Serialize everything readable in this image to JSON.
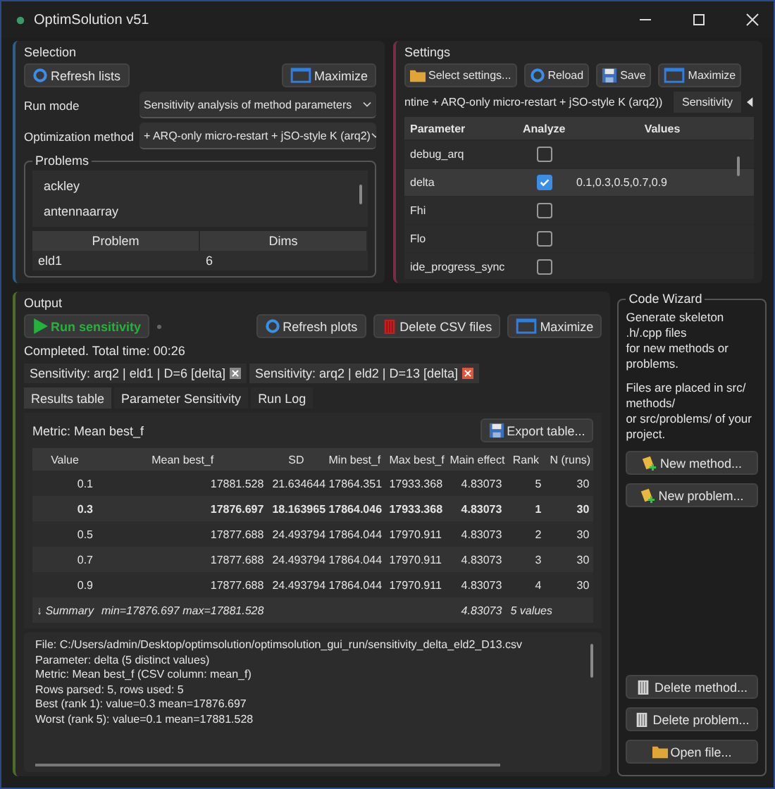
{
  "window": {
    "title": "OptimSolution v51"
  },
  "selection": {
    "title": "Selection",
    "refresh_button": "Refresh lists",
    "maximize_button": "Maximize",
    "fields": [
      {
        "label": "Run mode",
        "value": "Sensitivity analysis of method parameters"
      },
      {
        "label": "Optimization method",
        "value": "+ ARQ-only micro-restart + jSO-style K (arq2)"
      }
    ],
    "problems": {
      "title": "Problems",
      "items": [
        "ackley",
        "antennaarray"
      ],
      "columns": [
        "Problem",
        "Dims"
      ],
      "rows": [
        [
          "eld1",
          "6"
        ]
      ]
    }
  },
  "settings": {
    "title": "Settings",
    "buttons": [
      {
        "kind": "folder",
        "label": "Select settings..."
      },
      {
        "kind": "refresh",
        "label": "Reload"
      },
      {
        "kind": "save",
        "label": "Save"
      },
      {
        "kind": "maximize",
        "label": "Maximize"
      }
    ],
    "path": "ntine + ARQ-only micro-restart + jSO-style K (arq2))",
    "tab": "Sensitivity",
    "columns": [
      "Parameter",
      "Analyze",
      "Values"
    ],
    "rows": [
      {
        "name": "debug_arq",
        "checked": false,
        "values": "",
        "selected": false
      },
      {
        "name": "delta",
        "checked": true,
        "values": "0.1,0.3,0.5,0.7,0.9",
        "selected": true
      },
      {
        "name": "Fhi",
        "checked": false,
        "values": "",
        "selected": false
      },
      {
        "name": "Flo",
        "checked": false,
        "values": "",
        "selected": false
      },
      {
        "name": "ide_progress_sync",
        "checked": false,
        "values": "",
        "selected": false
      }
    ]
  },
  "output": {
    "title": "Output",
    "run_button": "Run sensitivity",
    "buttons": [
      {
        "kind": "refresh",
        "label": "Refresh plots"
      },
      {
        "kind": "delete",
        "label": "Delete CSV files"
      },
      {
        "kind": "maximize",
        "label": "Maximize"
      }
    ],
    "status": "Completed. Total time: 00:26",
    "file_tabs": [
      {
        "label": "Sensitivity: arq2 | eld1 | D=6 [delta]",
        "selected": false
      },
      {
        "label": "Sensitivity: arq2 | eld2 | D=13 [delta]",
        "selected": true
      }
    ],
    "tabs": [
      {
        "label": "Results table",
        "selected": true
      },
      {
        "label": "Parameter Sensitivity",
        "selected": false
      },
      {
        "label": "Run Log",
        "selected": false
      }
    ],
    "metric": "Metric: Mean best_f",
    "export_button": "Export table...",
    "table": {
      "columns": [
        "Value",
        "Mean best_f",
        "SD",
        "Min best_f",
        "Max best_f",
        "Main effect",
        "Rank",
        "N (runs)"
      ],
      "rows": [
        {
          "kind": "normal",
          "cells": [
            "0.1",
            "17881.528",
            "21.634644",
            "17864.351",
            "17933.368",
            "4.83073",
            "5",
            "30"
          ]
        },
        {
          "kind": "best",
          "cells": [
            "0.3",
            "17876.697",
            "18.163965",
            "17864.046",
            "17933.368",
            "4.83073",
            "1",
            "30"
          ]
        },
        {
          "kind": "normal",
          "cells": [
            "0.5",
            "17877.688",
            "24.493794",
            "17864.044",
            "17970.911",
            "4.83073",
            "2",
            "30"
          ]
        },
        {
          "kind": "normal",
          "cells": [
            "0.7",
            "17877.688",
            "24.493794",
            "17864.044",
            "17970.911",
            "4.83073",
            "3",
            "30"
          ]
        },
        {
          "kind": "normal",
          "cells": [
            "0.9",
            "17877.688",
            "24.493794",
            "17864.044",
            "17970.911",
            "4.83073",
            "4",
            "30"
          ]
        },
        {
          "kind": "summary",
          "cells": [
            "↓ Summary",
            "min=17876.697  max=17881.528",
            "",
            "",
            "",
            "4.83073",
            "5 values",
            ""
          ]
        }
      ]
    },
    "log": [
      "File: C:/Users/admin/Desktop/optimsolution/optimsolution_gui_run/sensitivity_delta_eld2_D13.csv",
      "Parameter: delta  (5 distinct values)",
      "Metric: Mean best_f (CSV column: mean_f)",
      "Rows parsed: 5, rows used: 5",
      "Best  (rank 1): value=0.3  mean=17876.697",
      "Worst (rank 5): value=0.1  mean=17881.528"
    ]
  },
  "code_wizard": {
    "title": "Code Wizard",
    "description": [
      "Generate skeleton .h/.cpp files\nfor new methods or problems.",
      "Files are placed in src/\nmethods/\nor src/problems/ of your project."
    ],
    "buttons": [
      {
        "kind": "new",
        "label": "New method..."
      },
      {
        "kind": "new",
        "label": "New problem..."
      },
      {
        "kind": "delete",
        "label": "Delete method..."
      },
      {
        "kind": "delete",
        "label": "Delete problem..."
      },
      {
        "kind": "folder",
        "label": "Open file..."
      }
    ]
  }
}
